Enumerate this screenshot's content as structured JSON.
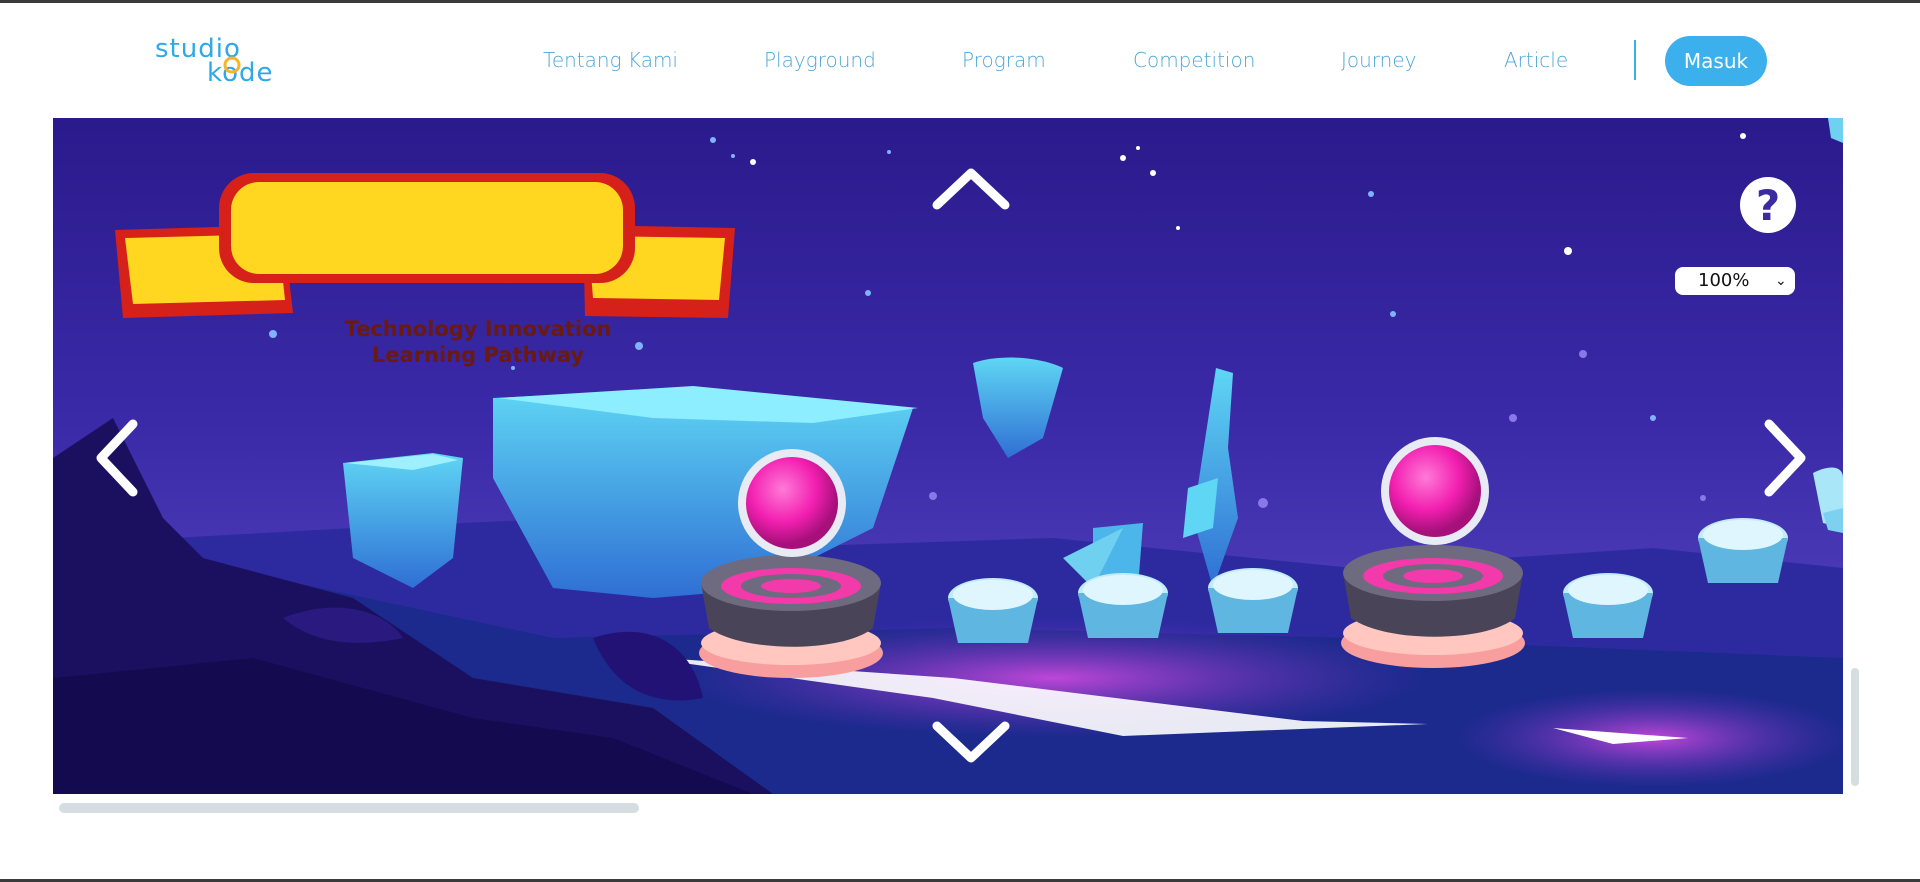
{
  "header": {
    "logo": {
      "line1": "studio",
      "line2": "kode",
      "brand_color": "#2ea8e8",
      "accent_color": "#f6b42a"
    },
    "nav": [
      {
        "label": "Tentang Kami"
      },
      {
        "label": "Playground"
      },
      {
        "label": "Program"
      },
      {
        "label": "Competition"
      },
      {
        "label": "Journey"
      },
      {
        "label": "Article"
      }
    ],
    "login_label": "Masuk"
  },
  "game": {
    "banner_title_line1": "Technology Innovation",
    "banner_title_line2": "Learning Pathway",
    "help_label": "?",
    "zoom": {
      "selected": "100%"
    },
    "icons": {
      "up": "chevron-up-icon",
      "down": "chevron-down-icon",
      "left": "chevron-left-icon",
      "right": "chevron-right-icon",
      "help": "question-icon"
    },
    "colors": {
      "sky": "#3a2aa8",
      "ice": "#5cc8ee",
      "orb": "#ff2fb8",
      "banner": "#ffd620",
      "banner_border": "#d6201a"
    }
  }
}
